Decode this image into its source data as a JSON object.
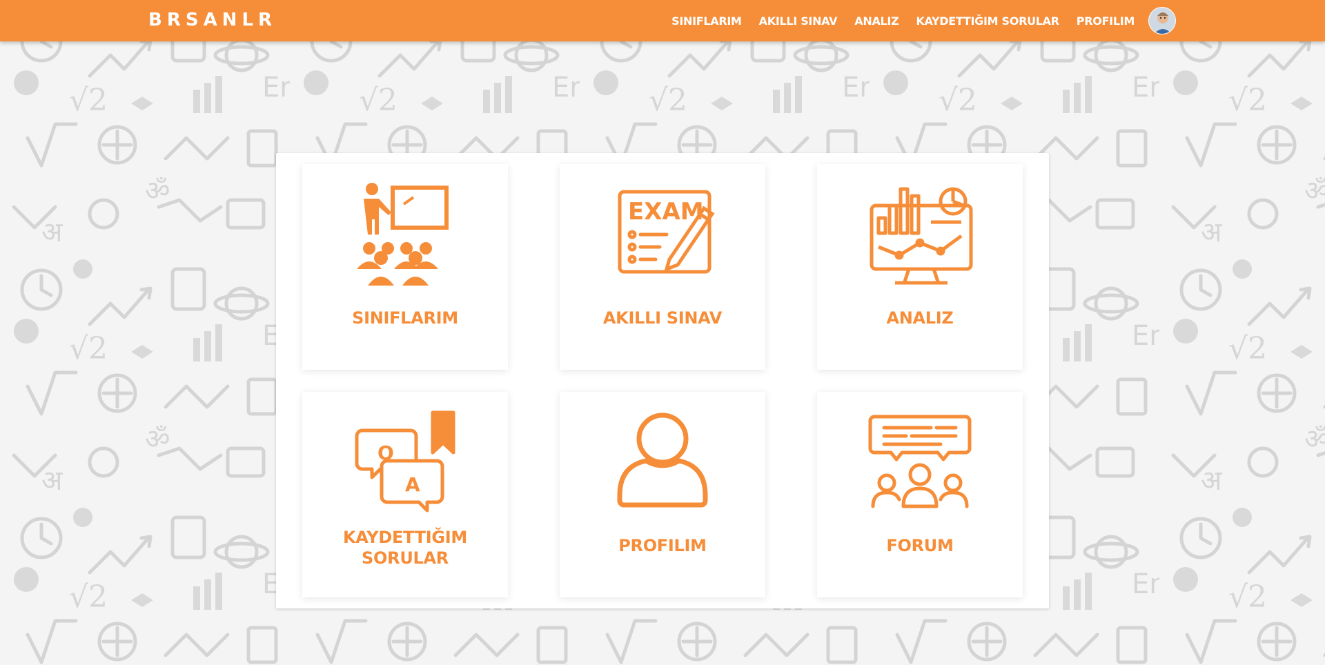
{
  "brand": "BRSANLR",
  "colors": {
    "accent": "#f68d38",
    "background": "#f4f4f4",
    "pattern": "#d6d6d6"
  },
  "nav": {
    "items": [
      {
        "label": "SINIFLARIM"
      },
      {
        "label": "AKILLI SINAV"
      },
      {
        "label": "ANALIZ"
      },
      {
        "label": "KAYDETTIĞIM SORULAR"
      },
      {
        "label": "PROFILIM"
      }
    ],
    "avatar_icon": "user-avatar"
  },
  "cards": [
    {
      "label": "SINIFLARIM",
      "icon": "classroom-teacher-icon"
    },
    {
      "label": "AKILLI SINAV",
      "icon": "exam-pencil-icon",
      "icon_text": "EXAM"
    },
    {
      "label": "ANALIZ",
      "icon": "analytics-monitor-icon"
    },
    {
      "label_line1": "KAYDETTIĞIM",
      "label_line2": "SORULAR",
      "icon": "qa-bookmark-icon",
      "icon_text_q": "Q",
      "icon_text_a": "A"
    },
    {
      "label": "PROFILIM",
      "icon": "user-profile-icon"
    },
    {
      "label": "FORUM",
      "icon": "forum-group-chat-icon"
    }
  ]
}
